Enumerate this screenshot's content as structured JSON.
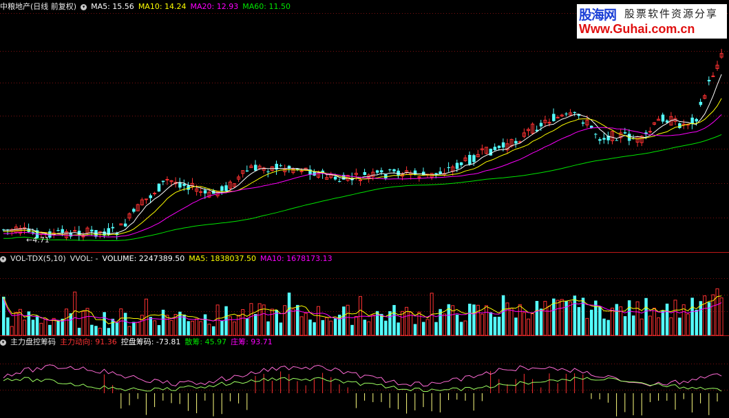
{
  "main_panel": {
    "stock_title": "中粮地产(日线 前复权)",
    "ma5": "MA5: 15.56",
    "ma10": "MA10: 14.24",
    "ma20": "MA20: 12.93",
    "ma60": "MA60: 11.50",
    "min_price_label": "4.71"
  },
  "volume_panel": {
    "indicator": "VOL-TDX(5,10)",
    "vvol": "VVOL: -",
    "volume": "VOLUME: 2247389.50",
    "ma5": "MA5: 1838037.50",
    "ma10": "MA10: 1678173.13"
  },
  "indicator_panel": {
    "name": "主力盘控筹码",
    "main_force": "主力动向: 91.36",
    "control": "控盘筹码: -73.81",
    "retail": "散筹: 45.97",
    "dealer": "庄筹: 93.71"
  },
  "watermark": {
    "site_name": "股海网",
    "slogan": "股票软件资源分享",
    "url": "Www.Guhai.com.cn"
  },
  "colors": {
    "up": "#ff3232",
    "down": "#54ffff",
    "ma5": "#ffffff",
    "ma10": "#ffff00",
    "ma20": "#ff00ff",
    "ma60": "#00e600",
    "grid": "#801010"
  }
}
